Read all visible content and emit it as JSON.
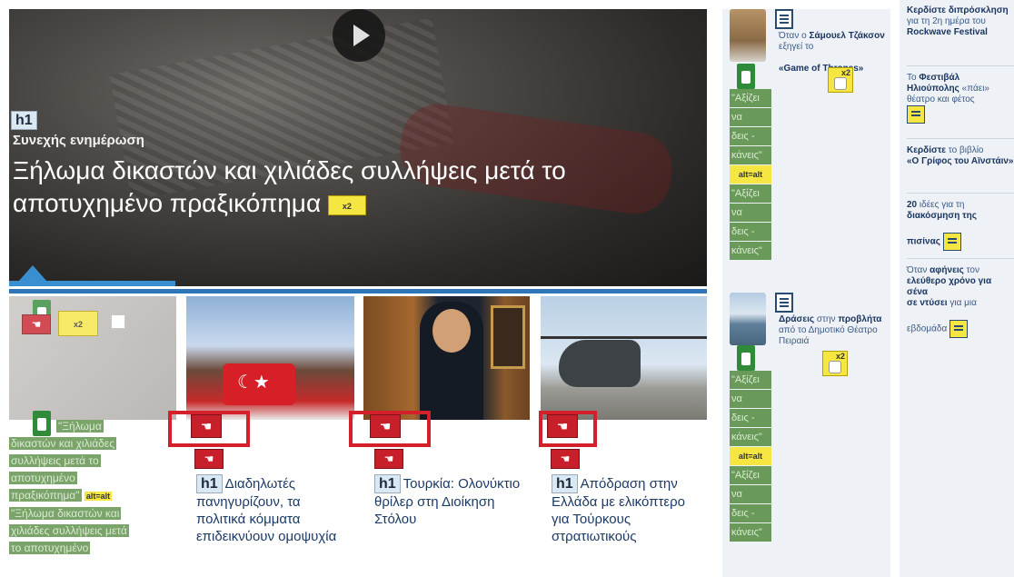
{
  "hero": {
    "h1_tag": "h1",
    "kicker": "Συνεχής ενημέρωση",
    "title": "Ξήλωμα δικαστών και χιλιάδες συλλήψεις μετά το αποτυχημένο πραξικόπημα",
    "badge": "x2"
  },
  "thumbs": [
    {
      "h1_tag": "h1",
      "caption": "Διαδηλωτές πανηγυρίζουν, τα πολιτικά κόμματα επιδεικνύουν ομοψυχία"
    },
    {
      "h1_tag": "h1",
      "caption": "Τουρκία: Ολονύκτιο θρίλερ στη Διοίκηση Στόλου"
    },
    {
      "h1_tag": "h1",
      "caption": "Απόδραση στην Ελλάδα με ελικόπτερο για Τούρκους στρατιωτικούς"
    }
  ],
  "left_alt": {
    "lines": [
      "\"Ξήλωμα",
      "δικαστών και χιλιάδες",
      "συλλήψεις μετά το",
      "αποτυχημένο",
      "πραξικόπημα\""
    ],
    "alt_badge": "alt=alt",
    "lines2": [
      "\"Ξήλωμα δικαστών και",
      "χιλιάδες συλλήψεις μετά",
      "το αποτυχημένο"
    ]
  },
  "rc1": {
    "item1": {
      "pre": "Όταν ο ",
      "name": "Σάμουελ Τζάκσον",
      "mid": " εξηγεί το ",
      "show": "«Game of Thrones»"
    },
    "item2": {
      "bold": "Δράσεις",
      "rest": " στην ",
      "bold2": "προβλήτα",
      "rest2": " από το Δημοτικό Θέατρο Πειραιά"
    },
    "alt_stack": [
      "\"Αξίζει",
      "να",
      "δεις -",
      "κάνεις\""
    ],
    "alt_badge": "alt=alt",
    "x2": "x2"
  },
  "rc2": {
    "i1_line1": "Κερδίστε διπρόσκληση",
    "i1_line2": "για τη 2η ημέρα του",
    "i1_bold": "Rockwave Festival",
    "i2_pre": "Το ",
    "i2_bold": "Φεστιβάλ Ηλιούπολης",
    "i2_rest": " «πάει» θέατρο και φέτος",
    "i3_bold": "Κερδίστε",
    "i3_rest": " το βιβλίο",
    "i3_bold2": "«Ο Γρίφος του Αϊνστάιν»",
    "i4_bold": "20",
    "i4_rest": " ιδέες για τη ",
    "i4_bold2": "διακόσμηση της",
    "i4_bold3": "πισίνας",
    "i5_pre": "Όταν ",
    "i5_bold": "αφήνεις",
    "i5_rest": " τον ",
    "i5_bold2": "ελεύθερο χρόνο για σένα",
    "i5_rest2": " ",
    "i5_bold3": "σε ντύσει",
    "i5_rest3": " για μια",
    "i5_tail": "εβδομάδα"
  }
}
